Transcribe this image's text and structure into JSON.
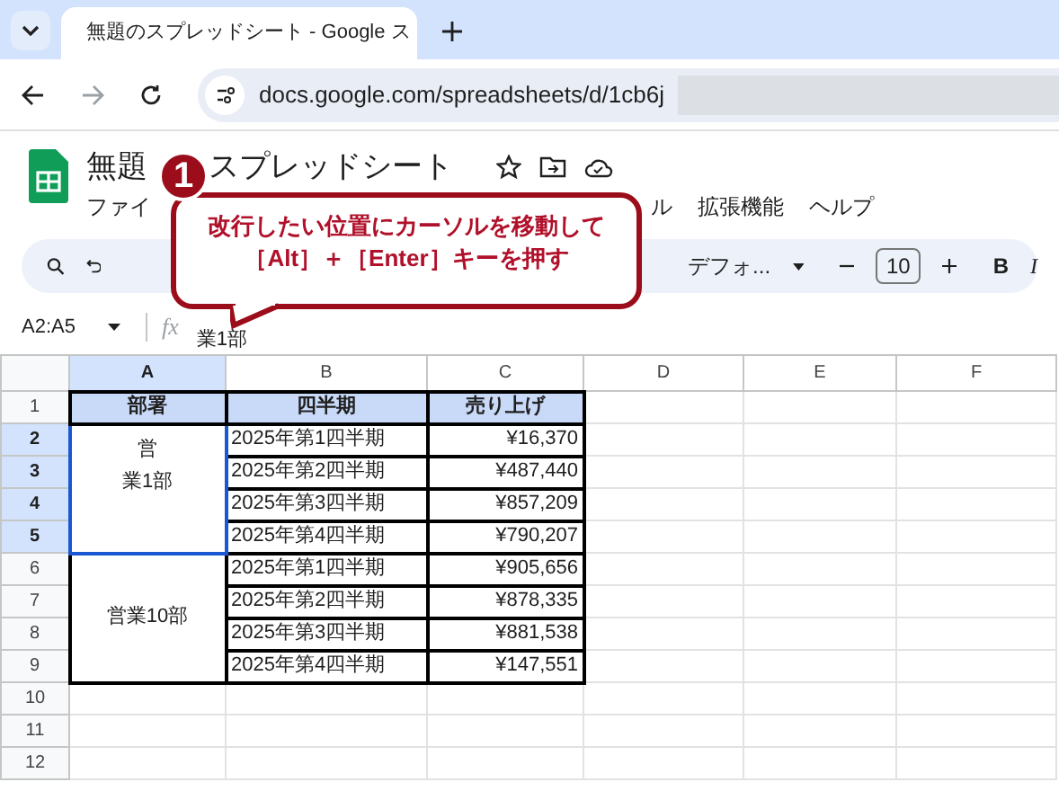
{
  "browser": {
    "tab_title": "無題のスプレッドシート - Google ス",
    "url": "docs.google.com/spreadsheets/d/1cb6j"
  },
  "doc": {
    "title_parts": [
      "無題",
      "スプレッドシート"
    ],
    "menu": [
      "ファイ",
      "ル",
      "拡張機能",
      "ヘルプ"
    ]
  },
  "toolbar": {
    "font": "デフォ...",
    "font_size": "10",
    "bold": "B",
    "italic": "I"
  },
  "formula_bar": {
    "name_box": "A2:A5",
    "fx": "fx",
    "value": "業1部"
  },
  "columns": [
    {
      "label": "A",
      "selected": true
    },
    {
      "label": "B",
      "selected": false
    },
    {
      "label": "C",
      "selected": false
    },
    {
      "label": "D",
      "selected": false
    },
    {
      "label": "E",
      "selected": false
    },
    {
      "label": "F",
      "selected": false
    }
  ],
  "rows": [
    {
      "label": "1",
      "selected": false
    },
    {
      "label": "2",
      "selected": true
    },
    {
      "label": "3",
      "selected": true
    },
    {
      "label": "4",
      "selected": true
    },
    {
      "label": "5",
      "selected": true
    },
    {
      "label": "6",
      "selected": false
    },
    {
      "label": "7",
      "selected": false
    },
    {
      "label": "8",
      "selected": false
    },
    {
      "label": "9",
      "selected": false
    },
    {
      "label": "10",
      "selected": false
    },
    {
      "label": "11",
      "selected": false
    },
    {
      "label": "12",
      "selected": false
    }
  ],
  "table": {
    "header": [
      "部署",
      "四半期",
      "売り上げ"
    ],
    "groups": [
      {
        "dept": [
          "営",
          "業1部"
        ],
        "selected": true,
        "rows": [
          [
            "2025年第1四半期",
            "¥16,370"
          ],
          [
            "2025年第2四半期",
            "¥487,440"
          ],
          [
            "2025年第3四半期",
            "¥857,209"
          ],
          [
            "2025年第4四半期",
            "¥790,207"
          ]
        ]
      },
      {
        "dept": [
          "営業10部"
        ],
        "selected": false,
        "rows": [
          [
            "2025年第1四半期",
            "¥905,656"
          ],
          [
            "2025年第2四半期",
            "¥878,335"
          ],
          [
            "2025年第3四半期",
            "¥881,538"
          ],
          [
            "2025年第4四半期",
            "¥147,551"
          ]
        ]
      }
    ]
  },
  "callout": {
    "number": "1",
    "lines": [
      "改行したい位置にカーソルを移動して",
      "［Alt］＋［Enter］キーを押す"
    ]
  }
}
